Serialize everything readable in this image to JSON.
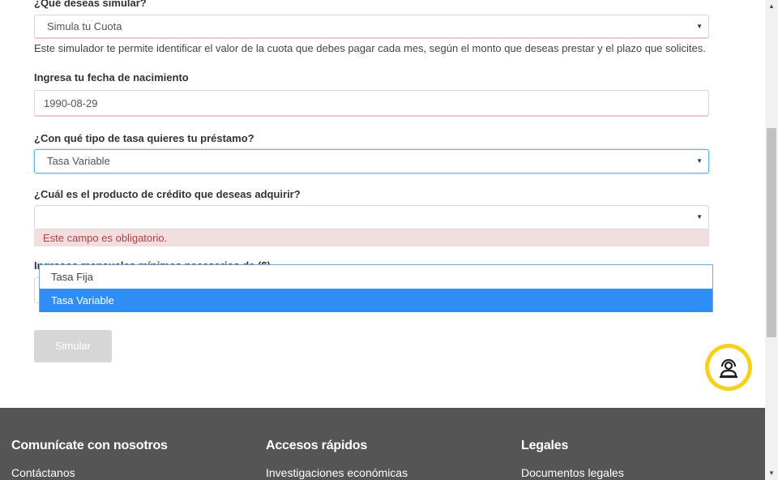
{
  "form": {
    "q1_label": "¿Qué deseas simular?",
    "q1_value": "Simula tu Cuota",
    "q1_help": "Este simulador te permite identificar el valor de la cuota que debes pagar cada mes, según el monto que deseas prestar y el plazo que solicites.",
    "birth_label": "Ingresa tu fecha de nacimiento",
    "birth_value": "1990-08-29",
    "rate_label": "¿Con qué tipo de tasa quieres tu préstamo?",
    "rate_value": "Tasa Variable",
    "product_label": "¿Cuál es el producto de crédito que deseas adquirir?",
    "product_value": "",
    "product_error": "Este campo es obligatorio.",
    "income_label": "Ingresos mensuales mínimos necesarios de ($)",
    "caret": "▼"
  },
  "dropdown": {
    "options": [
      "Tasa Fija",
      "Tasa Variable"
    ],
    "selected": "Tasa Variable"
  },
  "button": {
    "simulate": "Simular"
  },
  "footer": {
    "col1_title": "Comunícate con nosotros",
    "col1_link": "Contáctanos",
    "col2_title": "Accesos rápidos",
    "col2_link": "Investigaciones económicas",
    "col3_title": "Legales",
    "col3_link": "Documentos legales"
  },
  "scroll": {
    "up": "▲",
    "down": "▼"
  },
  "colors": {
    "accent": "#2f8ef5",
    "chat_ring": "#f4d21c",
    "footer_bg": "#555555",
    "error_bg": "#f2dede",
    "error_text": "#a94442"
  },
  "icons": {
    "chat": "chat-support-icon"
  }
}
